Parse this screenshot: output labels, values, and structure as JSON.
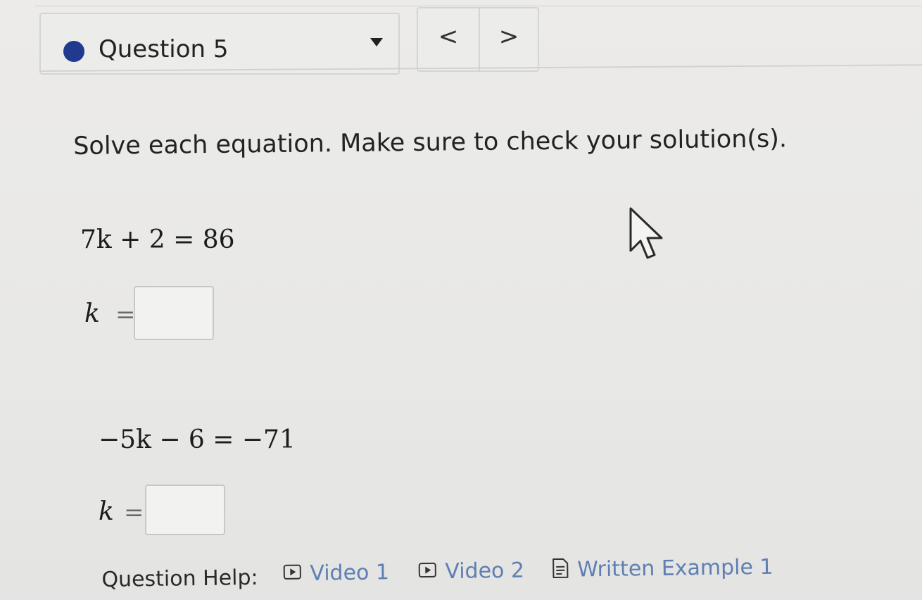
{
  "question_selector": {
    "label": "Question 5",
    "status_color": "#1f3a8f"
  },
  "nav": {
    "prev": "<",
    "next": ">"
  },
  "instruction": "Solve each equation. Make sure to check your solution(s).",
  "problems": [
    {
      "equation": "7k + 2 = 86",
      "answer_label": "k",
      "equals": "=",
      "answer_value": ""
    },
    {
      "equation": "−5k − 6 = −71",
      "answer_label": "k",
      "equals": "=",
      "answer_value": ""
    }
  ],
  "help": {
    "label": "Question Help:",
    "links": [
      {
        "label": "Video 1",
        "icon": "video-icon"
      },
      {
        "label": "Video 2",
        "icon": "video-icon"
      },
      {
        "label": "Written Example 1",
        "icon": "document-icon"
      }
    ],
    "link_color": "#5f7fb4"
  }
}
